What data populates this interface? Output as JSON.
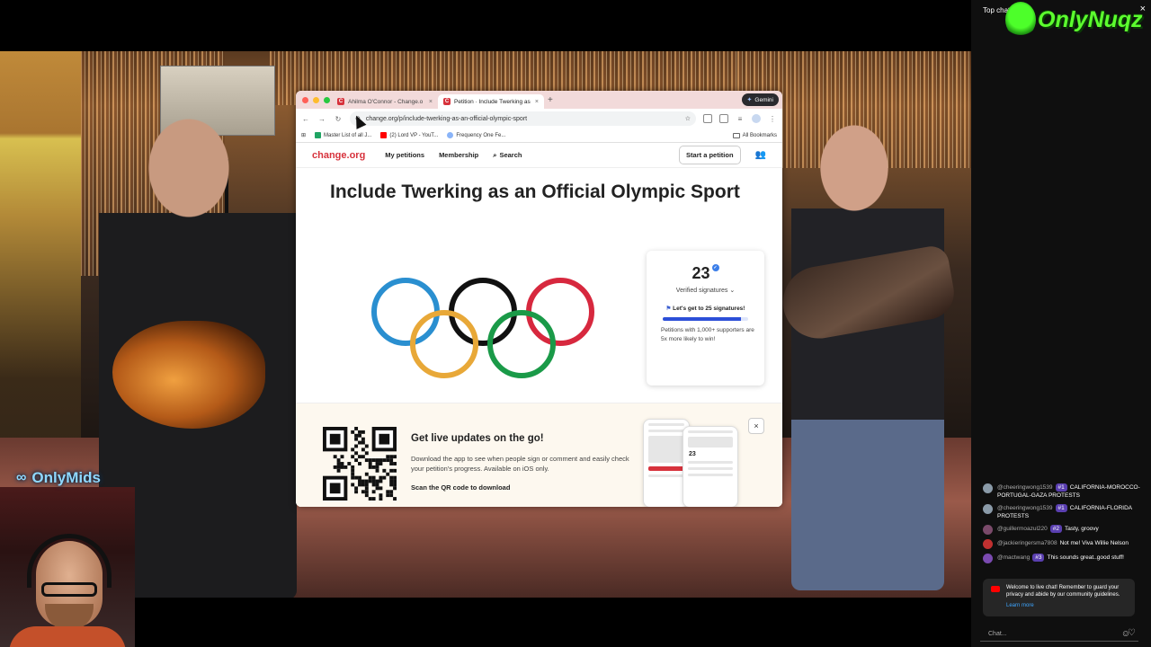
{
  "browser": {
    "tabs": [
      {
        "favicon": "change-icon",
        "title": "Ahilma O'Connor - Change.o",
        "active": false
      },
      {
        "favicon": "change-icon",
        "title": "Petition · Include Twerking as",
        "active": true
      }
    ],
    "gemini_label": "Gemini",
    "url": "change.org/p/include-twerking-as-an-official-olympic-sport",
    "bookmarks": [
      {
        "icon": "sheets-icon",
        "label": "Master List of all J..."
      },
      {
        "icon": "youtube-icon",
        "label": "(2) Lord VP - YouT..."
      },
      {
        "icon": "globe-icon",
        "label": "Frequency One Fe..."
      }
    ],
    "all_bookmarks_label": "All Bookmarks"
  },
  "site": {
    "logo": "change.org",
    "nav": {
      "my_petitions": "My petitions",
      "membership": "Membership",
      "search": "Search",
      "start_petition": "Start a petition"
    },
    "petition_title": "Include Twerking as an Official Olympic Sport",
    "signatures": {
      "count": "23",
      "verified_label": "Verified signatures",
      "goal_text": "Let's get to 25 signatures!",
      "progress_fraction": 0.92,
      "note": "Petitions with 1,000+ supporters are 5x more likely to win!"
    },
    "promo": {
      "heading": "Get live updates on the go!",
      "description": "Download the app to see when people sign or comment and easily check your petition's progress. Available on iOS only.",
      "scan_label": "Scan the QR code to download",
      "phone_count": "23"
    }
  },
  "overlay": {
    "onlymids_label": "OnlyMids",
    "onlynuqz_label": "OnlyNuqz"
  },
  "chat": {
    "header": "Top chat",
    "messages": [
      {
        "user": "@cheeringwong1539",
        "rank": "#1",
        "text": "CALIFORNIA-MOROCCO-PORTUGAL-GAZA PROTESTS",
        "avatar_color": "#8a9aa8"
      },
      {
        "user": "@cheeringwong1539",
        "rank": "#1",
        "text": "CALIFORNIA-FLORIDA PROTESTS",
        "avatar_color": "#8a9aa8"
      },
      {
        "user": "@guillermoazul220",
        "rank": "#2",
        "text": "Tasty, groovy",
        "avatar_color": "#7a4a6a"
      },
      {
        "user": "@jackieringersma7808",
        "rank": "",
        "text": "Not me! Viva Willie Nelson",
        "avatar_color": "#c03030"
      },
      {
        "user": "@mactwang",
        "rank": "#3",
        "text": "This sounds great..good stuff!",
        "avatar_color": "#7a4ab0"
      }
    ],
    "notice_text": "Welcome to live chat! Remember to guard your privacy and abide by our community guidelines.",
    "learn_more": "Learn more",
    "input_placeholder": "Chat..."
  }
}
